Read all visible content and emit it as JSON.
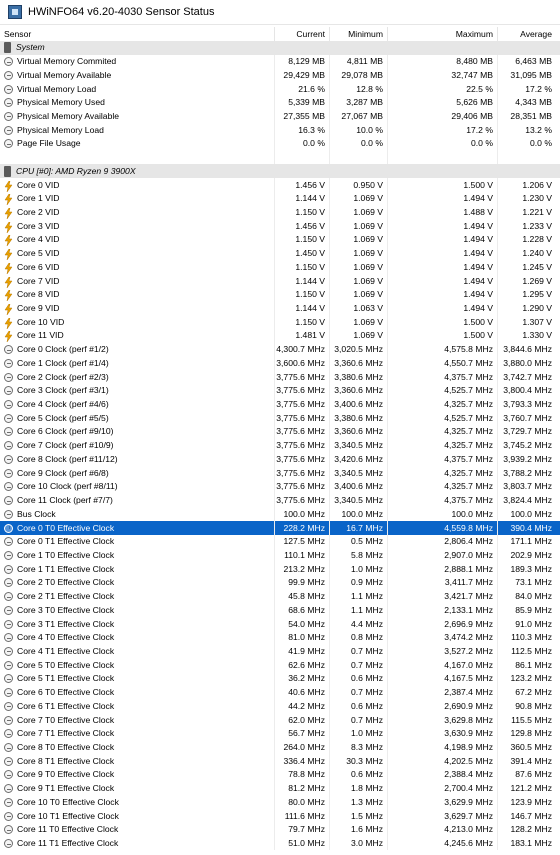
{
  "window": {
    "title": "HWiNFO64 v6.20-4030 Sensor Status"
  },
  "columns": [
    "Sensor",
    "Current",
    "Minimum",
    "Maximum",
    "Average"
  ],
  "rows": [
    {
      "type": "group",
      "icon": "chip",
      "name": "System",
      "cur": "",
      "min": "",
      "max": "",
      "avg": ""
    },
    {
      "type": "item",
      "icon": "circle",
      "name": "Virtual Memory Commited",
      "cur": "8,129 MB",
      "min": "4,811 MB",
      "max": "8,480 MB",
      "avg": "6,463 MB"
    },
    {
      "type": "item",
      "icon": "circle",
      "name": "Virtual Memory Available",
      "cur": "29,429 MB",
      "min": "29,078 MB",
      "max": "32,747 MB",
      "avg": "31,095 MB"
    },
    {
      "type": "item",
      "icon": "circle",
      "name": "Virtual Memory Load",
      "cur": "21.6 %",
      "min": "12.8 %",
      "max": "22.5 %",
      "avg": "17.2 %"
    },
    {
      "type": "item",
      "icon": "circle",
      "name": "Physical Memory Used",
      "cur": "5,339 MB",
      "min": "3,287 MB",
      "max": "5,626 MB",
      "avg": "4,343 MB"
    },
    {
      "type": "item",
      "icon": "circle",
      "name": "Physical Memory Available",
      "cur": "27,355 MB",
      "min": "27,067 MB",
      "max": "29,406 MB",
      "avg": "28,351 MB"
    },
    {
      "type": "item",
      "icon": "circle",
      "name": "Physical Memory Load",
      "cur": "16.3 %",
      "min": "10.0 %",
      "max": "17.2 %",
      "avg": "13.2 %"
    },
    {
      "type": "item",
      "icon": "circle",
      "name": "Page File Usage",
      "cur": "0.0 %",
      "min": "0.0 %",
      "max": "0.0 %",
      "avg": "0.0 %"
    },
    {
      "type": "blank",
      "icon": "",
      "name": "",
      "cur": "",
      "min": "",
      "max": "",
      "avg": ""
    },
    {
      "type": "group",
      "icon": "chip",
      "name": "CPU [#0]: AMD Ryzen 9 3900X",
      "cur": "",
      "min": "",
      "max": "",
      "avg": ""
    },
    {
      "type": "item",
      "icon": "bolt",
      "name": "Core 0 VID",
      "cur": "1.456 V",
      "min": "0.950 V",
      "max": "1.500 V",
      "avg": "1.206 V"
    },
    {
      "type": "item",
      "icon": "bolt",
      "name": "Core 1 VID",
      "cur": "1.144 V",
      "min": "1.069 V",
      "max": "1.494 V",
      "avg": "1.230 V"
    },
    {
      "type": "item",
      "icon": "bolt",
      "name": "Core 2 VID",
      "cur": "1.150 V",
      "min": "1.069 V",
      "max": "1.488 V",
      "avg": "1.221 V"
    },
    {
      "type": "item",
      "icon": "bolt",
      "name": "Core 3 VID",
      "cur": "1.456 V",
      "min": "1.069 V",
      "max": "1.494 V",
      "avg": "1.233 V"
    },
    {
      "type": "item",
      "icon": "bolt",
      "name": "Core 4 VID",
      "cur": "1.150 V",
      "min": "1.069 V",
      "max": "1.494 V",
      "avg": "1.228 V"
    },
    {
      "type": "item",
      "icon": "bolt",
      "name": "Core 5 VID",
      "cur": "1.450 V",
      "min": "1.069 V",
      "max": "1.494 V",
      "avg": "1.240 V"
    },
    {
      "type": "item",
      "icon": "bolt",
      "name": "Core 6 VID",
      "cur": "1.150 V",
      "min": "1.069 V",
      "max": "1.494 V",
      "avg": "1.245 V"
    },
    {
      "type": "item",
      "icon": "bolt",
      "name": "Core 7 VID",
      "cur": "1.144 V",
      "min": "1.069 V",
      "max": "1.494 V",
      "avg": "1.269 V"
    },
    {
      "type": "item",
      "icon": "bolt",
      "name": "Core 8 VID",
      "cur": "1.150 V",
      "min": "1.069 V",
      "max": "1.494 V",
      "avg": "1.295 V"
    },
    {
      "type": "item",
      "icon": "bolt",
      "name": "Core 9 VID",
      "cur": "1.144 V",
      "min": "1.063 V",
      "max": "1.494 V",
      "avg": "1.290 V"
    },
    {
      "type": "item",
      "icon": "bolt",
      "name": "Core 10 VID",
      "cur": "1.150 V",
      "min": "1.069 V",
      "max": "1.500 V",
      "avg": "1.307 V"
    },
    {
      "type": "item",
      "icon": "bolt",
      "name": "Core 11 VID",
      "cur": "1.481 V",
      "min": "1.069 V",
      "max": "1.500 V",
      "avg": "1.330 V"
    },
    {
      "type": "item",
      "icon": "circle",
      "name": "Core 0 Clock (perf #1/2)",
      "cur": "4,300.7 MHz",
      "min": "3,020.5 MHz",
      "max": "4,575.8 MHz",
      "avg": "3,844.6 MHz"
    },
    {
      "type": "item",
      "icon": "circle",
      "name": "Core 1 Clock (perf #1/4)",
      "cur": "3,600.6 MHz",
      "min": "3,360.6 MHz",
      "max": "4,550.7 MHz",
      "avg": "3,880.0 MHz"
    },
    {
      "type": "item",
      "icon": "circle",
      "name": "Core 2 Clock (perf #2/3)",
      "cur": "3,775.6 MHz",
      "min": "3,380.6 MHz",
      "max": "4,375.7 MHz",
      "avg": "3,742.7 MHz"
    },
    {
      "type": "item",
      "icon": "circle",
      "name": "Core 3 Clock (perf #3/1)",
      "cur": "3,775.6 MHz",
      "min": "3,360.6 MHz",
      "max": "4,525.7 MHz",
      "avg": "3,800.4 MHz"
    },
    {
      "type": "item",
      "icon": "circle",
      "name": "Core 4 Clock (perf #4/6)",
      "cur": "3,775.6 MHz",
      "min": "3,400.6 MHz",
      "max": "4,325.7 MHz",
      "avg": "3,793.3 MHz"
    },
    {
      "type": "item",
      "icon": "circle",
      "name": "Core 5 Clock (perf #5/5)",
      "cur": "3,775.6 MHz",
      "min": "3,380.6 MHz",
      "max": "4,525.7 MHz",
      "avg": "3,760.7 MHz"
    },
    {
      "type": "item",
      "icon": "circle",
      "name": "Core 6 Clock (perf #9/10)",
      "cur": "3,775.6 MHz",
      "min": "3,360.6 MHz",
      "max": "4,325.7 MHz",
      "avg": "3,729.7 MHz"
    },
    {
      "type": "item",
      "icon": "circle",
      "name": "Core 7 Clock (perf #10/9)",
      "cur": "3,775.6 MHz",
      "min": "3,340.5 MHz",
      "max": "4,325.7 MHz",
      "avg": "3,745.2 MHz"
    },
    {
      "type": "item",
      "icon": "circle",
      "name": "Core 8 Clock (perf #11/12)",
      "cur": "3,775.6 MHz",
      "min": "3,420.6 MHz",
      "max": "4,375.7 MHz",
      "avg": "3,939.2 MHz"
    },
    {
      "type": "item",
      "icon": "circle",
      "name": "Core 9 Clock (perf #6/8)",
      "cur": "3,775.6 MHz",
      "min": "3,340.5 MHz",
      "max": "4,325.7 MHz",
      "avg": "3,788.2 MHz"
    },
    {
      "type": "item",
      "icon": "circle",
      "name": "Core 10 Clock (perf #8/11)",
      "cur": "3,775.6 MHz",
      "min": "3,400.6 MHz",
      "max": "4,325.7 MHz",
      "avg": "3,803.7 MHz"
    },
    {
      "type": "item",
      "icon": "circle",
      "name": "Core 11 Clock (perf #7/7)",
      "cur": "3,775.6 MHz",
      "min": "3,340.5 MHz",
      "max": "4,375.7 MHz",
      "avg": "3,824.4 MHz"
    },
    {
      "type": "item",
      "icon": "circle",
      "name": "Bus Clock",
      "cur": "100.0 MHz",
      "min": "100.0 MHz",
      "max": "100.0 MHz",
      "avg": "100.0 MHz"
    },
    {
      "type": "sel",
      "icon": "clock",
      "name": "Core 0 T0 Effective Clock",
      "cur": "228.2 MHz",
      "min": "16.7 MHz",
      "max": "4,559.8 MHz",
      "avg": "390.4 MHz"
    },
    {
      "type": "item",
      "icon": "circle",
      "name": "Core 0 T1 Effective Clock",
      "cur": "127.5 MHz",
      "min": "0.5 MHz",
      "max": "2,806.4 MHz",
      "avg": "171.1 MHz"
    },
    {
      "type": "item",
      "icon": "circle",
      "name": "Core 1 T0 Effective Clock",
      "cur": "110.1 MHz",
      "min": "5.8 MHz",
      "max": "2,907.0 MHz",
      "avg": "202.9 MHz"
    },
    {
      "type": "item",
      "icon": "circle",
      "name": "Core 1 T1 Effective Clock",
      "cur": "213.2 MHz",
      "min": "1.0 MHz",
      "max": "2,888.1 MHz",
      "avg": "189.3 MHz"
    },
    {
      "type": "item",
      "icon": "circle",
      "name": "Core 2 T0 Effective Clock",
      "cur": "99.9 MHz",
      "min": "0.9 MHz",
      "max": "3,411.7 MHz",
      "avg": "73.1 MHz"
    },
    {
      "type": "item",
      "icon": "circle",
      "name": "Core 2 T1 Effective Clock",
      "cur": "45.8 MHz",
      "min": "1.1 MHz",
      "max": "3,421.7 MHz",
      "avg": "84.0 MHz"
    },
    {
      "type": "item",
      "icon": "circle",
      "name": "Core 3 T0 Effective Clock",
      "cur": "68.6 MHz",
      "min": "1.1 MHz",
      "max": "2,133.1 MHz",
      "avg": "85.9 MHz"
    },
    {
      "type": "item",
      "icon": "circle",
      "name": "Core 3 T1 Effective Clock",
      "cur": "54.0 MHz",
      "min": "4.4 MHz",
      "max": "2,696.9 MHz",
      "avg": "91.0 MHz"
    },
    {
      "type": "item",
      "icon": "circle",
      "name": "Core 4 T0 Effective Clock",
      "cur": "81.0 MHz",
      "min": "0.8 MHz",
      "max": "3,474.2 MHz",
      "avg": "110.3 MHz"
    },
    {
      "type": "item",
      "icon": "circle",
      "name": "Core 4 T1 Effective Clock",
      "cur": "41.9 MHz",
      "min": "0.7 MHz",
      "max": "3,527.2 MHz",
      "avg": "112.5 MHz"
    },
    {
      "type": "item",
      "icon": "circle",
      "name": "Core 5 T0 Effective Clock",
      "cur": "62.6 MHz",
      "min": "0.7 MHz",
      "max": "4,167.0 MHz",
      "avg": "86.1 MHz"
    },
    {
      "type": "item",
      "icon": "circle",
      "name": "Core 5 T1 Effective Clock",
      "cur": "36.2 MHz",
      "min": "0.6 MHz",
      "max": "4,167.5 MHz",
      "avg": "123.2 MHz"
    },
    {
      "type": "item",
      "icon": "circle",
      "name": "Core 6 T0 Effective Clock",
      "cur": "40.6 MHz",
      "min": "0.7 MHz",
      "max": "2,387.4 MHz",
      "avg": "67.2 MHz"
    },
    {
      "type": "item",
      "icon": "circle",
      "name": "Core 6 T1 Effective Clock",
      "cur": "44.2 MHz",
      "min": "0.6 MHz",
      "max": "2,690.9 MHz",
      "avg": "90.8 MHz"
    },
    {
      "type": "item",
      "icon": "circle",
      "name": "Core 7 T0 Effective Clock",
      "cur": "62.0 MHz",
      "min": "0.7 MHz",
      "max": "3,629.8 MHz",
      "avg": "115.5 MHz"
    },
    {
      "type": "item",
      "icon": "circle",
      "name": "Core 7 T1 Effective Clock",
      "cur": "56.7 MHz",
      "min": "1.0 MHz",
      "max": "3,630.9 MHz",
      "avg": "129.8 MHz"
    },
    {
      "type": "item",
      "icon": "circle",
      "name": "Core 8 T0 Effective Clock",
      "cur": "264.0 MHz",
      "min": "8.3 MHz",
      "max": "4,198.9 MHz",
      "avg": "360.5 MHz"
    },
    {
      "type": "item",
      "icon": "circle",
      "name": "Core 8 T1 Effective Clock",
      "cur": "336.4 MHz",
      "min": "30.3 MHz",
      "max": "4,202.5 MHz",
      "avg": "391.4 MHz"
    },
    {
      "type": "item",
      "icon": "circle",
      "name": "Core 9 T0 Effective Clock",
      "cur": "78.8 MHz",
      "min": "0.6 MHz",
      "max": "2,388.4 MHz",
      "avg": "87.6 MHz"
    },
    {
      "type": "item",
      "icon": "circle",
      "name": "Core 9 T1 Effective Clock",
      "cur": "81.2 MHz",
      "min": "1.8 MHz",
      "max": "2,700.4 MHz",
      "avg": "121.2 MHz"
    },
    {
      "type": "item",
      "icon": "circle",
      "name": "Core 10 T0 Effective Clock",
      "cur": "80.0 MHz",
      "min": "1.3 MHz",
      "max": "3,629.9 MHz",
      "avg": "123.9 MHz"
    },
    {
      "type": "item",
      "icon": "circle",
      "name": "Core 10 T1 Effective Clock",
      "cur": "111.6 MHz",
      "min": "1.5 MHz",
      "max": "3,629.7 MHz",
      "avg": "146.7 MHz"
    },
    {
      "type": "item",
      "icon": "circle",
      "name": "Core 11 T0 Effective Clock",
      "cur": "79.7 MHz",
      "min": "1.6 MHz",
      "max": "4,213.0 MHz",
      "avg": "128.2 MHz"
    },
    {
      "type": "item",
      "icon": "circle",
      "name": "Core 11 T1 Effective Clock",
      "cur": "51.0 MHz",
      "min": "3.0 MHz",
      "max": "4,245.6 MHz",
      "avg": "183.1 MHz"
    }
  ],
  "colors": {
    "selection": "#0a64c8",
    "group_bg": "#e6e6e6",
    "bolt": "#e8a000"
  }
}
